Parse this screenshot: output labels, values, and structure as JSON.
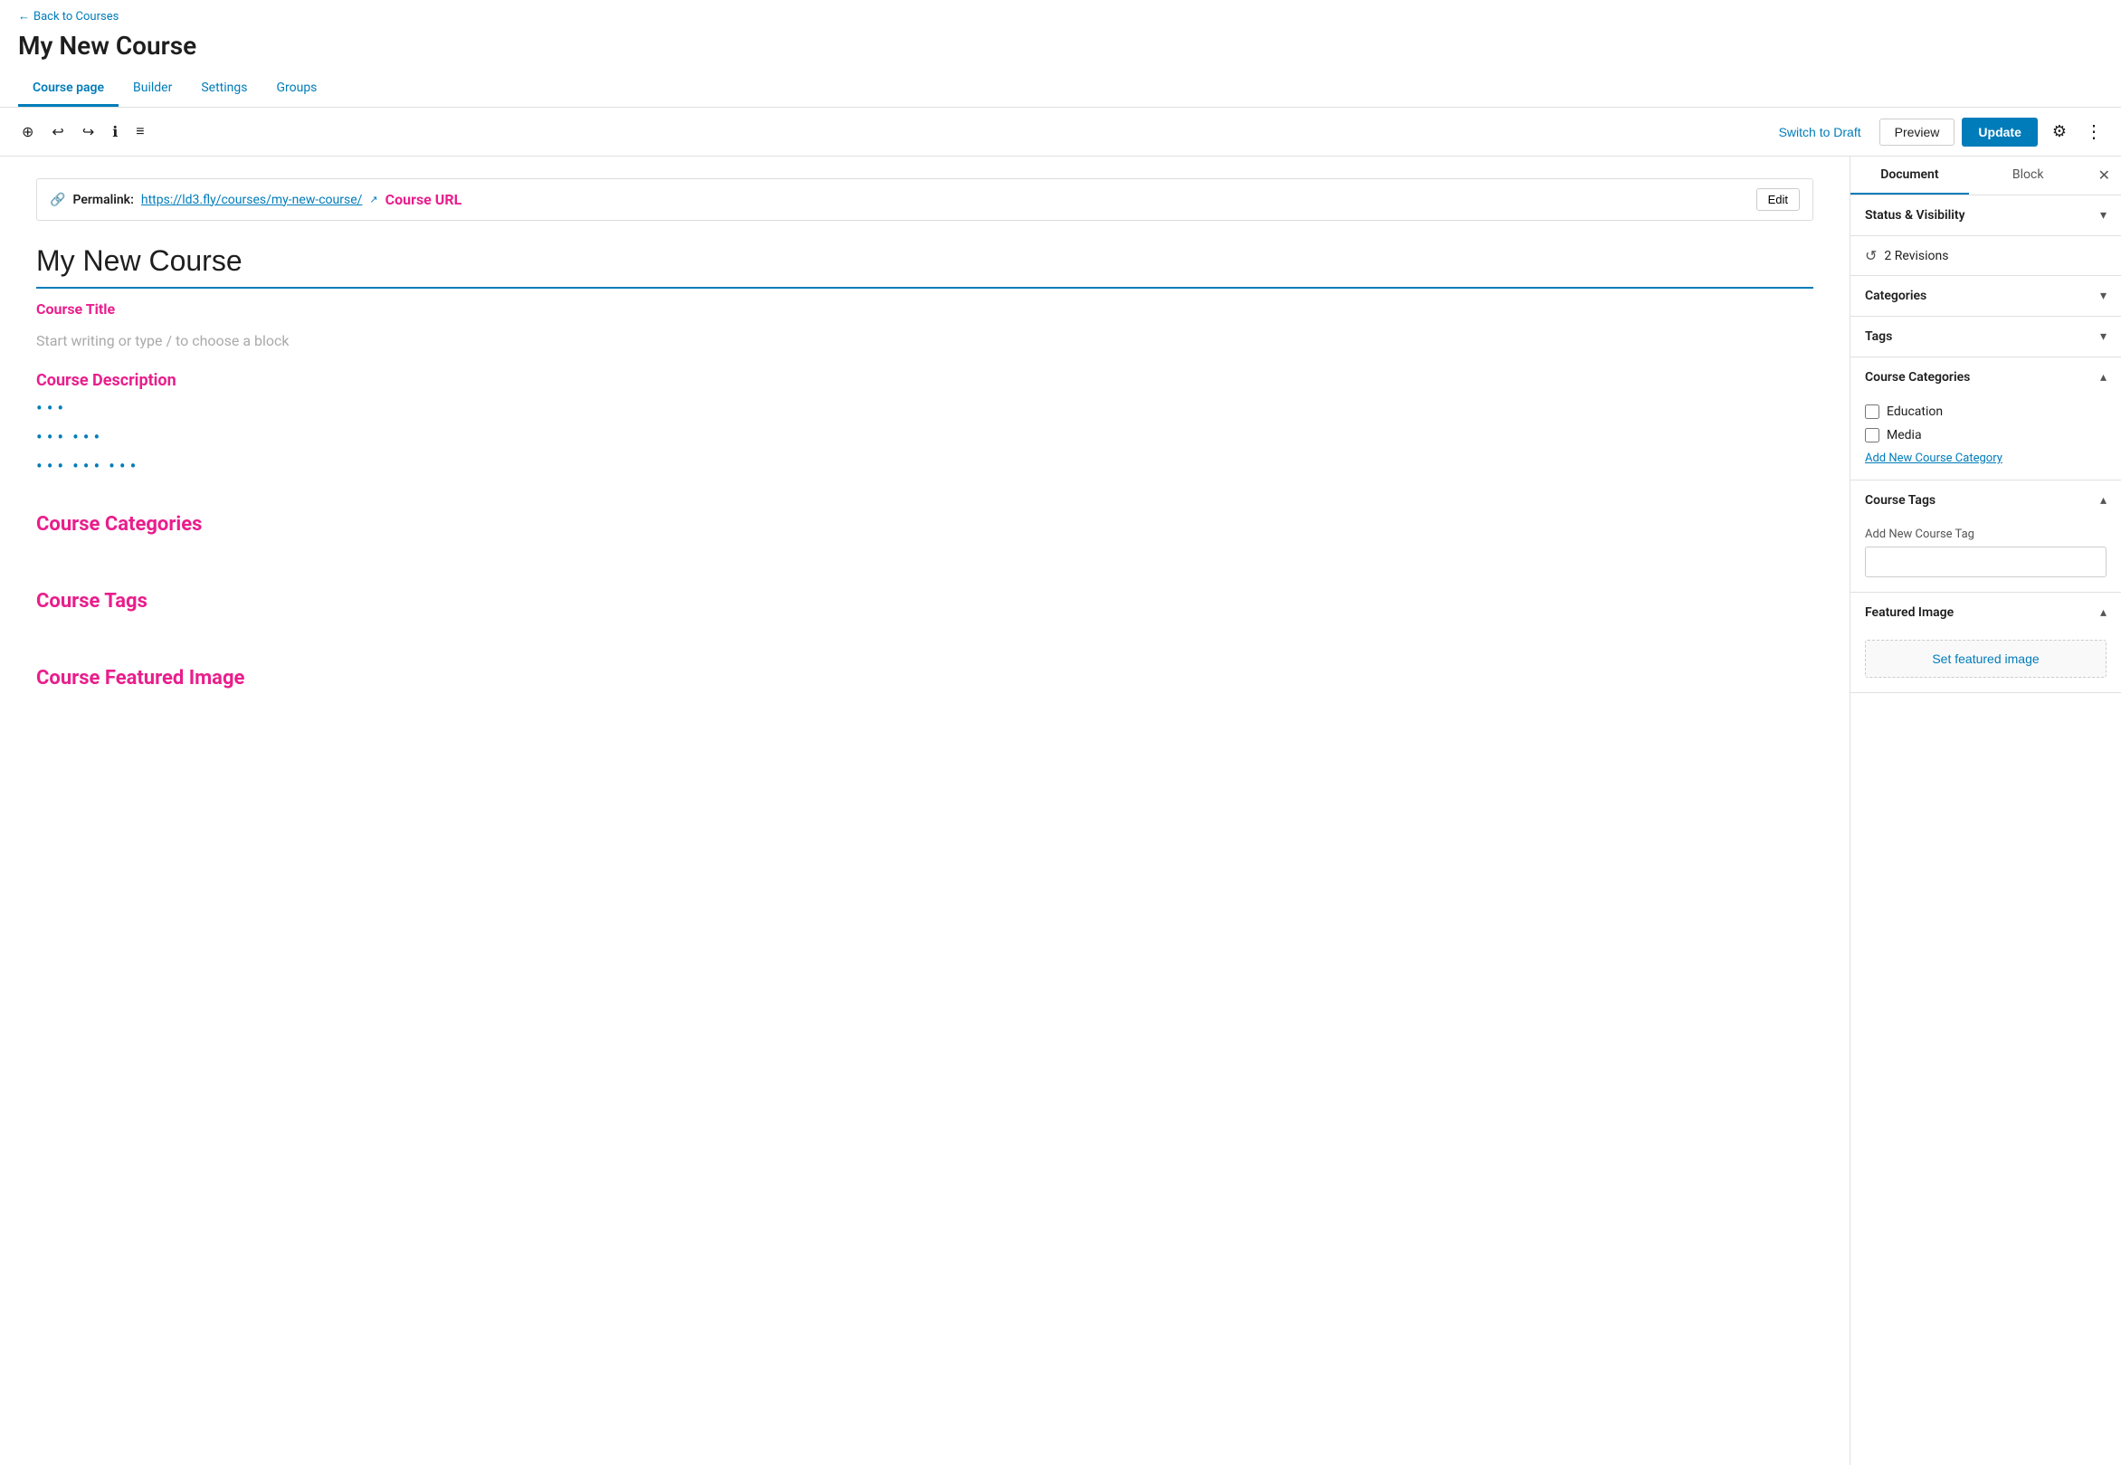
{
  "back_link": "Back to Courses",
  "page_title": "My New Course",
  "tabs": [
    {
      "id": "course-page",
      "label": "Course page",
      "active": true
    },
    {
      "id": "builder",
      "label": "Builder",
      "active": false
    },
    {
      "id": "settings",
      "label": "Settings",
      "active": false
    },
    {
      "id": "groups",
      "label": "Groups",
      "active": false
    }
  ],
  "toolbar": {
    "switch_draft_label": "Switch to Draft",
    "preview_label": "Preview",
    "update_label": "Update"
  },
  "editor": {
    "permalink_label": "Permalink:",
    "permalink_url": "https://ld3.fly/courses/my-new-course/",
    "edit_label": "Edit",
    "course_title": "My New Course",
    "placeholder": "Start writing or type / to choose a block"
  },
  "annotations": {
    "course_url": "Course URL",
    "course_title": "Course Title",
    "course_description": "Course Description",
    "course_categories": "Course Categories",
    "course_tags": "Course Tags",
    "course_featured_image": "Course Featured Image"
  },
  "sidebar": {
    "doc_tab": "Document",
    "block_tab": "Block",
    "sections": {
      "status_visibility": "Status & Visibility",
      "revisions": "2 Revisions",
      "categories": "Categories",
      "tags": "Tags",
      "course_categories": "Course Categories",
      "course_tags": "Course Tags",
      "featured_image": "Featured Image"
    },
    "course_categories_items": [
      {
        "label": "Education",
        "checked": false
      },
      {
        "label": "Media",
        "checked": false
      }
    ],
    "add_category_label": "Add New Course Category",
    "tag_input_label": "Add New Course Tag",
    "tag_placeholder": "",
    "set_featured_label": "Set featured image"
  }
}
